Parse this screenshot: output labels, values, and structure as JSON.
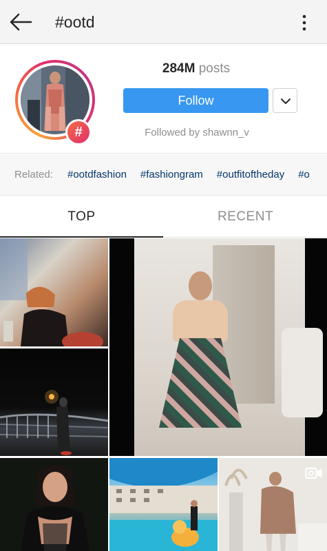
{
  "header": {
    "title": "#ootd"
  },
  "profile": {
    "posts_count": "284M",
    "posts_label": "posts",
    "follow_label": "Follow",
    "followed_by": "Followed by shawnn_v",
    "hashtag_badge": "#"
  },
  "related": {
    "label": "Related:",
    "tags": [
      "#ootdfashion",
      "#fashiongram",
      "#outfitoftheday",
      "#o"
    ]
  },
  "tabs": {
    "top": "TOP",
    "recent": "RECENT"
  },
  "icons": {
    "back": "back-arrow-icon",
    "more": "more-vertical-icon",
    "dropdown": "chevron-down-icon",
    "video": "video-icon"
  },
  "colors": {
    "accent": "#3897f0",
    "tag_link": "#003569",
    "muted": "#8e8e8e"
  }
}
